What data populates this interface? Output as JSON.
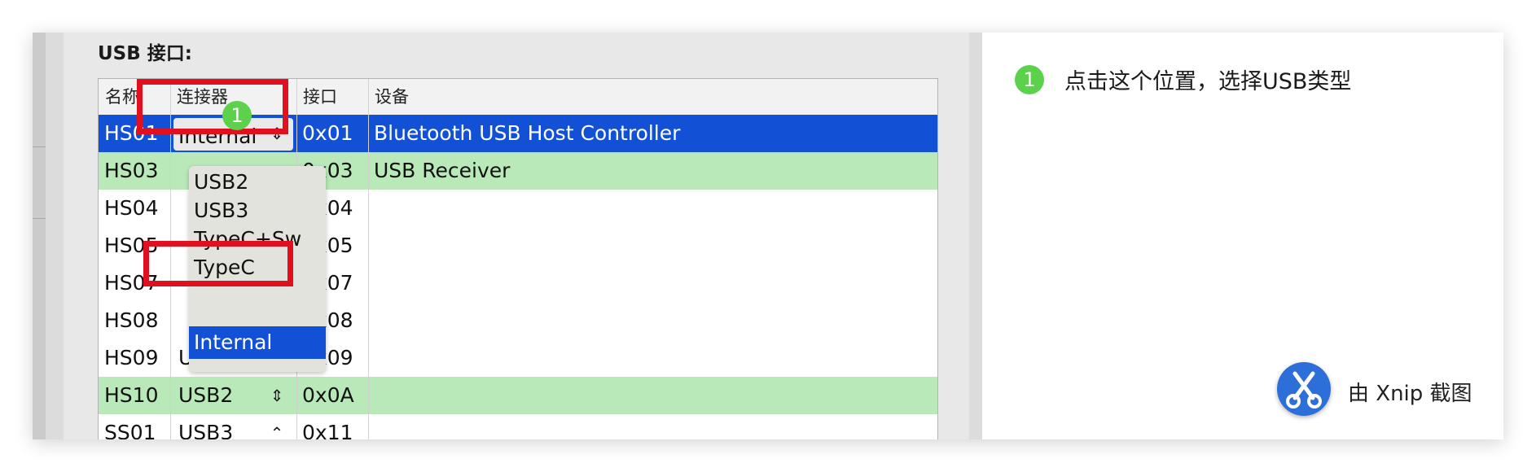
{
  "section_title": "USB 接口:",
  "columns": [
    "名称",
    "连接器",
    "接口",
    "设备"
  ],
  "rows": [
    {
      "name": "HS01",
      "connector": "Internal",
      "port": "0x01",
      "device": "Bluetooth USB Host Controller",
      "state": "selected"
    },
    {
      "name": "HS03",
      "connector": "",
      "port": "0x03",
      "device": "USB Receiver",
      "state": "green"
    },
    {
      "name": "HS04",
      "connector": "",
      "port": "0x04",
      "device": "",
      "state": "normal"
    },
    {
      "name": "HS05",
      "connector": "",
      "port": "0x05",
      "device": "",
      "state": "normal"
    },
    {
      "name": "HS07",
      "connector": "",
      "port": "0x07",
      "device": "",
      "state": "normal"
    },
    {
      "name": "HS08",
      "connector": "",
      "port": "0x08",
      "device": "",
      "state": "normal"
    },
    {
      "name": "HS09",
      "connector": "USB2",
      "port": "0x09",
      "device": "",
      "state": "normal"
    },
    {
      "name": "HS10",
      "connector": "USB2",
      "port": "0x0A",
      "device": "",
      "state": "green"
    },
    {
      "name": "SS01",
      "connector": "USB3",
      "port": "0x11",
      "device": "",
      "state": "normal"
    }
  ],
  "dropdown": {
    "options": [
      "USB2",
      "USB3",
      "TypeC+Sw",
      "TypeC",
      "Internal"
    ],
    "selected": "Internal"
  },
  "annotation": {
    "number": "1",
    "text": "点击这个位置，选择USB类型"
  },
  "watermark": {
    "text": "由 Xnip 截图"
  },
  "colors": {
    "selected_row": "#1250d6",
    "green_row": "#b9e9b9",
    "highlight_box": "#e0101f",
    "badge": "#5cd24c"
  }
}
